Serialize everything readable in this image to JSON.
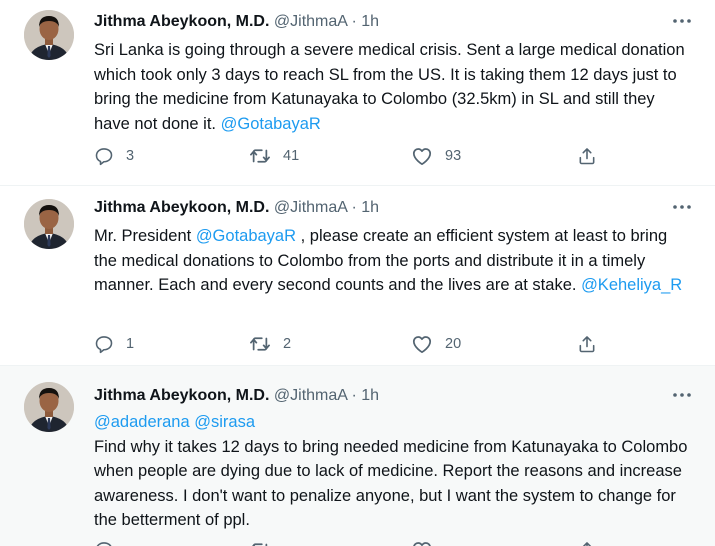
{
  "tweets": [
    {
      "author_name": "Jithma Abeykoon, M.D.",
      "handle": "@JithmaA",
      "separator": "·",
      "time": "1h",
      "text_part1": "Sri Lanka is going through a severe medical crisis. Sent a large medical donation which took only 3 days to reach SL from the US. It is taking them 12 days just to bring the medicine from Katunayaka to Colombo (32.5km) in SL and still they have not done it.",
      "mention": "@GotabayaR",
      "reply_count": "3",
      "retweet_count": "41",
      "like_count": "93"
    },
    {
      "author_name": "Jithma Abeykoon, M.D.",
      "handle": "@JithmaA",
      "separator": "·",
      "time": "1h",
      "text_prefix": "Mr. President",
      "mention": "@GotabayaR",
      "text_part2": ", please create an efficient system at least to bring the medical donations to Colombo from the ports and distribute it in a timely manner. Each and every second counts and the lives are at stake.",
      "mention2": "@Keheliya_R",
      "reply_count": "1",
      "retweet_count": "2",
      "like_count": "20"
    },
    {
      "author_name": "Jithma Abeykoon, M.D.",
      "handle": "@JithmaA",
      "separator": "·",
      "time": "1h",
      "mention": "@adaderana",
      "mention2": "@sirasa",
      "text_part1": "Find why it takes 12 days to bring needed medicine from Katunayaka to Colombo when people are dying due to lack of medicine. Report the reasons and increase awareness. I don't want to penalize anyone, but I want the system to change for the betterment of ppl."
    }
  ],
  "icons": {
    "reply": "reply-icon",
    "retweet": "retweet-icon",
    "like": "heart-icon",
    "share": "share-icon",
    "more": "more-options-icon"
  },
  "colors": {
    "link": "#1d9bf0",
    "text": "#0f1419",
    "muted": "#536471",
    "thread_line": "#cfd9de",
    "highlight_bg": "#f7f9f9"
  }
}
